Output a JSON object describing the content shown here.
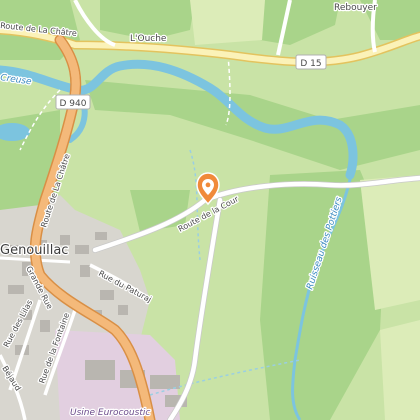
{
  "labels": {
    "route_la_chatre_top": "Route de La Châtre",
    "l_ouche": "L'Ouche",
    "rebouyer": "Rebouyer",
    "d15": "D 15",
    "creuse": "Creuse",
    "d940": "D 940",
    "route_la_chatre_side": "Route de La Châtre",
    "route_de_la_cour": "Route de la Cour",
    "ruisseau_des_pottiers": "Ruisseau des Pottiers",
    "genouillac": "Genouillac",
    "grande_rue": "Grande Rue",
    "rue_du_paturaj": "Rue du Paturaj",
    "rue_des_lilas": "Rue des Lilas",
    "rue_de_la_fontaine": "Rue de la Fontaine",
    "bejaud": "Béjaud",
    "usine_eurocoustic": "Usine Eurocoustic"
  },
  "marker": {
    "icon": "location-pin-icon",
    "color": "#f08a3a"
  },
  "colors": {
    "meadow": "#c9e3a6",
    "forest": "#a9d48a",
    "water": "#7cc4df",
    "road_fill": "#fbf2b8",
    "road_casing": "#e3c35e",
    "main_road": "#f4b97a",
    "main_road_casing": "#d98f45",
    "built_up": "#d8d6cf",
    "building": "#b9b6b0",
    "industrial": "#e2cfe0"
  }
}
